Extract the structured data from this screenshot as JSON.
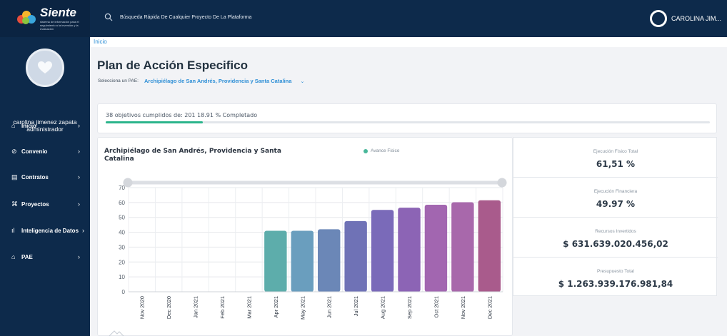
{
  "brand": {
    "name": "Siente",
    "tagline": "sistema de información para el seguimiento a la inversión y la evaluación"
  },
  "topbar": {
    "search_placeholder": "Búsqueda Rápida De Cualquier Proyecto De La Plataforma",
    "user_name": "CAROLINA JIM..."
  },
  "sidebar": {
    "user_name": "carolina jimenez zapata",
    "user_role": "administrador",
    "items": [
      {
        "label": "Inicio",
        "icon": "home-icon"
      },
      {
        "label": "Convenio",
        "icon": "link-icon"
      },
      {
        "label": "Contratos",
        "icon": "document-icon"
      },
      {
        "label": "Proyectos",
        "icon": "command-icon"
      },
      {
        "label": "Inteligencia de Datos",
        "icon": "bar-chart-icon"
      },
      {
        "label": "PAE",
        "icon": "home-icon"
      }
    ]
  },
  "breadcrumb": "Inicio",
  "page": {
    "title": "Plan de Acción Especifico",
    "pae_label": "Selecciona un PAE:",
    "pae_value": "Archipiélago de San Andrés, Providencia y Santa Catalina"
  },
  "progress": {
    "text": "38 objetivos cumplidos de: 201 18.91 % Completado",
    "fraction": 0.1891
  },
  "colors": {
    "navy": "#0d2a4b",
    "accent_blue": "#2e8fd6",
    "progress_green": "#2bb48b",
    "legend_green": "#48b79a"
  },
  "chart_data": {
    "type": "bar",
    "title": "Archipiélago de San Andrés, Providencia y Santa Catalina",
    "series_name": "Avance Fisico",
    "categories": [
      "Nov 2020",
      "Dec 2020",
      "Jan 2021",
      "Feb 2021",
      "Mar 2021",
      "Apr 2021",
      "May 2021",
      "Jun 2021",
      "Jul 2021",
      "Aug 2021",
      "Sep 2021",
      "Oct 2021",
      "Nov 2021",
      "Dec 2021"
    ],
    "values": [
      0,
      0,
      0,
      0,
      0,
      41,
      41,
      42,
      47.5,
      55,
      56.5,
      58.5,
      60.2,
      61.5
    ],
    "ylim": [
      0,
      70
    ],
    "yticks": [
      0,
      10,
      20,
      30,
      40,
      50,
      60,
      70
    ],
    "grid": true,
    "legend_position": "top",
    "bar_colors": [
      "#5aa8a4",
      "#5aa8a4",
      "#5aa8a4",
      "#5aa8a4",
      "#5aa8a4",
      "#5dadab",
      "#6a9ebe",
      "#6b87b7",
      "#6f72b6",
      "#7a6ab9",
      "#8c64b5",
      "#a266b0",
      "#a868ab",
      "#a95b8c"
    ]
  },
  "stats": [
    {
      "label": "Ejecución Fisico Total",
      "value": "61,51 %"
    },
    {
      "label": "Ejecución Financiera",
      "value": "49.97 %"
    },
    {
      "label": "Recursos Invertidos",
      "value": "$ 631.639.020.456,02"
    },
    {
      "label": "Presupuesto Total",
      "value": "$ 1.263.939.176.981,84"
    }
  ]
}
